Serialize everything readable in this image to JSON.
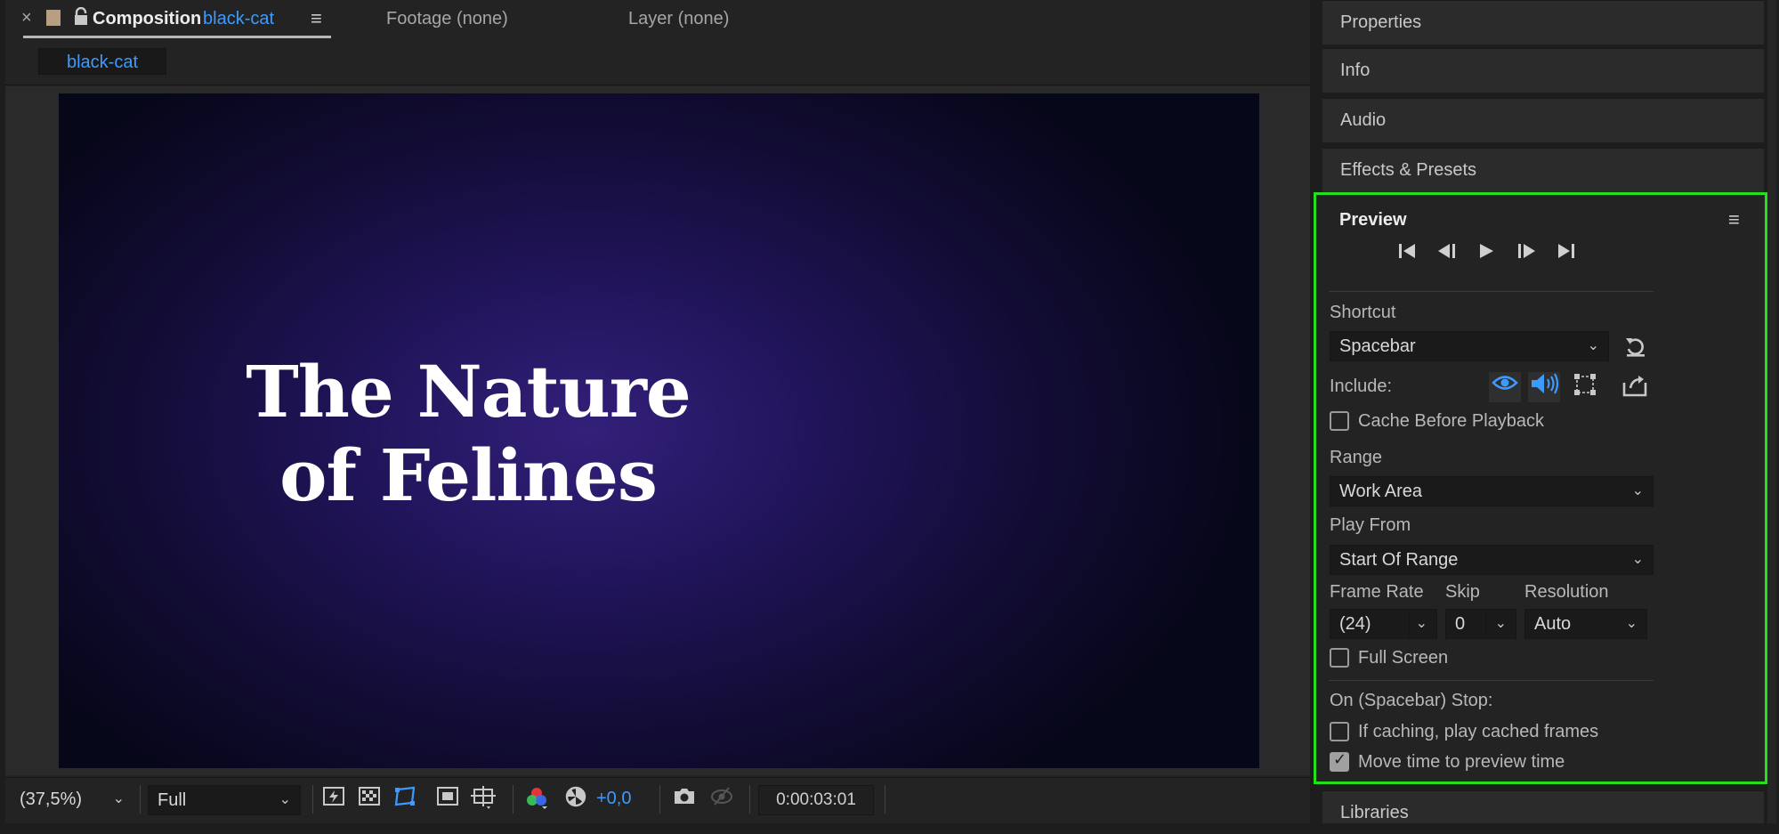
{
  "comp_tabs": {
    "close_glyph": "×",
    "composition_label": "Composition",
    "composition_name": "black-cat",
    "footage_tab": "Footage (none)",
    "layer_tab": "Layer (none)"
  },
  "comp_subtab": "black-cat",
  "canvas": {
    "title_line1": "The Nature",
    "title_line2": "of Felines"
  },
  "viewer_toolbar": {
    "zoom": "(37,5%)",
    "resolution": "Full",
    "exposure": "+0,0",
    "timecode": "0:00:03:01"
  },
  "right_panels": {
    "properties": "Properties",
    "info": "Info",
    "audio": "Audio",
    "effects": "Effects & Presets",
    "libraries": "Libraries"
  },
  "preview": {
    "title": "Preview",
    "shortcut_label": "Shortcut",
    "shortcut_value": "Spacebar",
    "include_label": "Include:",
    "cache_before_playback": "Cache Before Playback",
    "range_label": "Range",
    "range_value": "Work Area",
    "play_from_label": "Play From",
    "play_from_value": "Start Of Range",
    "frame_rate_label": "Frame Rate",
    "frame_rate_value": "(24)",
    "skip_label": "Skip",
    "skip_value": "0",
    "resolution_label": "Resolution",
    "resolution_value": "Auto",
    "full_screen": "Full Screen",
    "on_stop_label": "On (Spacebar) Stop:",
    "if_caching": "If caching, play cached frames",
    "move_time": "Move time to preview time",
    "cache_before_playback_checked": false,
    "full_screen_checked": false,
    "if_caching_checked": false,
    "move_time_checked": true
  },
  "colors": {
    "accent_blue": "#3d9bff",
    "highlight_green": "#22e01c"
  }
}
